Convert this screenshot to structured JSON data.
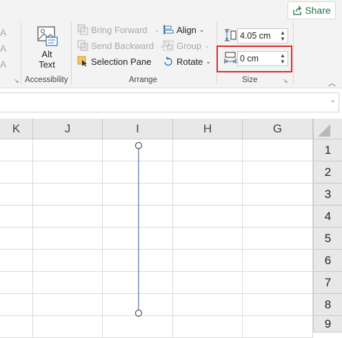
{
  "share": {
    "label": "Share",
    "icon": "share-icon"
  },
  "accessibility": {
    "alt_text_line1": "Alt",
    "alt_text_line2": "Text",
    "group_label": "Accessibility"
  },
  "arrange": {
    "bring_forward": "Bring Forward",
    "send_backward": "Send Backward",
    "selection_pane": "Selection Pane",
    "align": "Align",
    "group": "Group",
    "rotate": "Rotate",
    "group_label": "Arrange"
  },
  "size": {
    "height_value": "4.05 cm",
    "width_value": "0 cm",
    "group_label": "Size"
  },
  "columns": [
    "K",
    "J",
    "I",
    "H",
    "G"
  ],
  "rows": [
    "1",
    "2",
    "3",
    "4",
    "5",
    "6",
    "7",
    "8",
    "9"
  ],
  "colors": {
    "accent_green": "#217346",
    "highlight_red": "#e0262b",
    "line_blue": "#6b85b8"
  }
}
